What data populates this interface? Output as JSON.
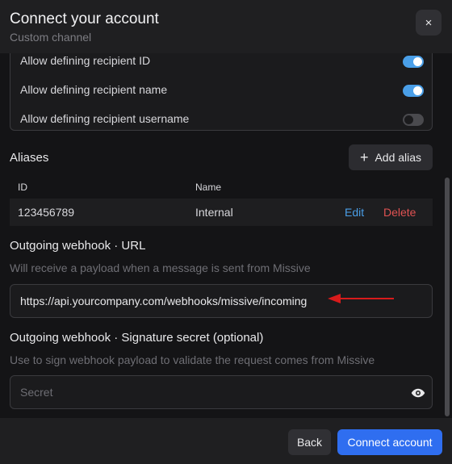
{
  "header": {
    "title": "Connect your account",
    "subtitle": "Custom channel",
    "close_label": "×"
  },
  "permissions": [
    {
      "label": "Allow defining recipient ID",
      "enabled": true
    },
    {
      "label": "Allow defining recipient name",
      "enabled": true
    },
    {
      "label": "Allow defining recipient username",
      "enabled": false
    }
  ],
  "aliases": {
    "title": "Aliases",
    "add_label": "Add alias",
    "columns": [
      "ID",
      "Name"
    ],
    "rows": [
      {
        "id": "123456789",
        "name": "Internal",
        "edit": "Edit",
        "delete": "Delete"
      }
    ]
  },
  "webhook_url": {
    "title": "Outgoing webhook · URL",
    "help": "Will receive a payload when a message is sent from Missive",
    "value": "https://api.yourcompany.com/webhooks/missive/incoming"
  },
  "webhook_secret": {
    "title": "Outgoing webhook · Signature secret (optional)",
    "help": "Use to sign webhook payload to validate the request comes from Missive",
    "placeholder": "Secret"
  },
  "footer": {
    "back_label": "Back",
    "connect_label": "Connect account"
  },
  "colors": {
    "accent": "#2f6ef0",
    "toggle_on": "#4a9fe8",
    "delete": "#e05252",
    "annotation_arrow": "#d81b1b"
  },
  "icons": {
    "close": "close-icon",
    "add": "plus-icon",
    "visibility": "eye-icon"
  }
}
